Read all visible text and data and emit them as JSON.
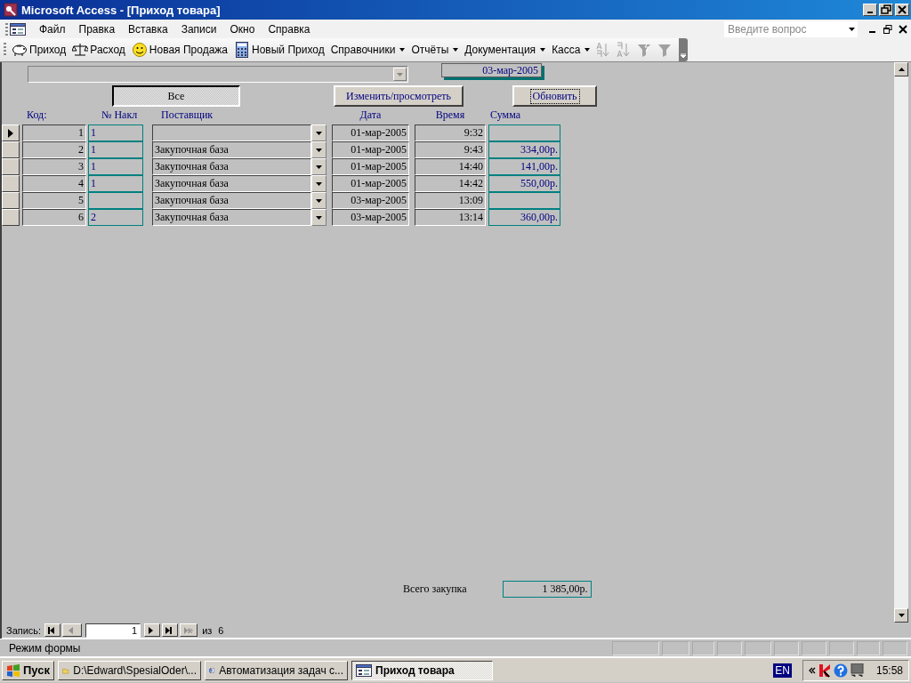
{
  "window": {
    "title": "Microsoft Access - [Приход товара]"
  },
  "menu": [
    "Файл",
    "Правка",
    "Вставка",
    "Записи",
    "Окно",
    "Справка"
  ],
  "help_field": {
    "placeholder": "Введите вопрос"
  },
  "toolbar": [
    {
      "kind": "button",
      "label": "Приход"
    },
    {
      "kind": "button",
      "label": "Расход"
    },
    {
      "kind": "button",
      "label": "Новая Продажа"
    },
    {
      "kind": "button",
      "label": "Новый Приход"
    },
    {
      "kind": "menu",
      "label": "Справочники"
    },
    {
      "kind": "menu",
      "label": "Отчёты"
    },
    {
      "kind": "menu",
      "label": "Документация"
    },
    {
      "kind": "menu",
      "label": "Касса"
    }
  ],
  "sort_filter_tools": [
    {
      "disabled": true
    },
    {
      "disabled": true
    },
    {
      "disabled": true
    },
    {
      "disabled": true
    }
  ],
  "form": {
    "date": "03-мар-2005",
    "filter_button": "Все",
    "edit_button": "Изменить/просмотреть",
    "refresh_button": "Обновить",
    "columns": [
      "Код:",
      "№ Накл",
      "Поставщик",
      "Дата",
      "Время",
      "Сумма"
    ],
    "rows": [
      {
        "selected": true,
        "code": "1",
        "invoice": "1",
        "date": "01-мар-2005",
        "time": "9:32"
      },
      {
        "selected": false,
        "code": "2",
        "invoice": "1",
        "supplier": "Закупочная база",
        "date": "01-мар-2005",
        "time": "9:43",
        "sum": "334,00р."
      },
      {
        "selected": false,
        "code": "3",
        "invoice": "1",
        "supplier": "Закупочная база",
        "date": "01-мар-2005",
        "time": "14:40",
        "sum": "141,00р."
      },
      {
        "selected": false,
        "code": "4",
        "invoice": "1",
        "supplier": "Закупочная база",
        "date": "01-мар-2005",
        "time": "14:42",
        "sum": "550,00р."
      },
      {
        "selected": false,
        "code": "5",
        "supplier": "Закупочная база",
        "date": "03-мар-2005",
        "time": "13:09"
      },
      {
        "selected": false,
        "code": "6",
        "invoice": "2",
        "supplier": "Закупочная база",
        "date": "03-мар-2005",
        "time": "13:14",
        "sum": "360,00р."
      }
    ],
    "total_label": "Всего закупка",
    "total": "1 385,00р."
  },
  "record_nav": {
    "label": "Запись:",
    "value": "1",
    "of": "из",
    "count": "6",
    "buttons": [
      {
        "disabled": false
      },
      {
        "disabled": true
      },
      {
        "disabled": false
      },
      {
        "disabled": false
      },
      {
        "disabled": true
      }
    ]
  },
  "status_bar": {
    "text": "Режим формы"
  },
  "taskbar": {
    "start": "Пуск",
    "tasks": [
      {
        "kind": "folder",
        "label": "D:\\Edward\\SpesialOder\\...",
        "selected": false
      },
      {
        "kind": "document",
        "label": "Автоматизация задач с...",
        "selected": false
      },
      {
        "kind": "form",
        "label": "Приход товара",
        "selected": true
      }
    ],
    "language": "EN",
    "clock": "15:58"
  }
}
